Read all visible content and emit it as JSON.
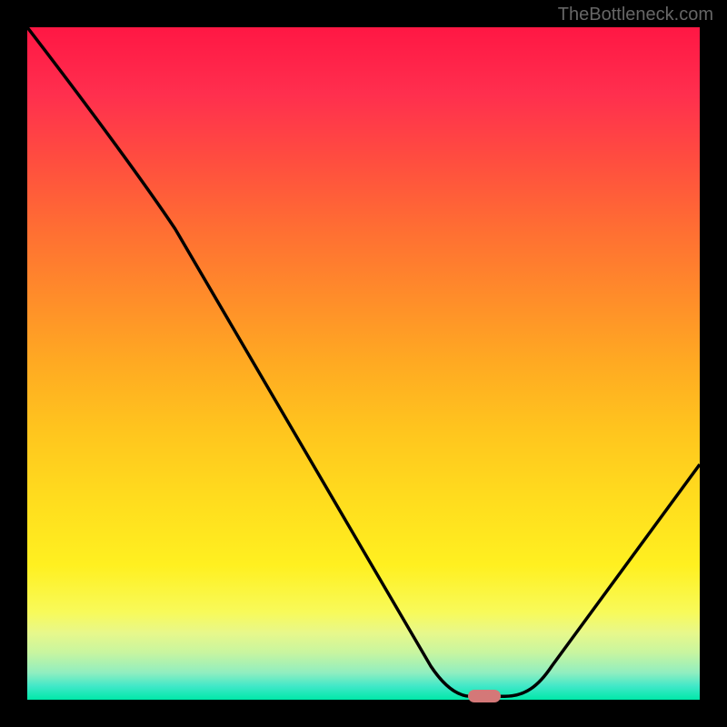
{
  "watermark": "TheBottleneck.com",
  "chart_data": {
    "type": "line",
    "title": "",
    "xlabel": "",
    "ylabel": "",
    "xlim": [
      0,
      100
    ],
    "ylim": [
      0,
      100
    ],
    "curve_points": [
      {
        "x": 0,
        "y": 100
      },
      {
        "x": 18,
        "y": 75
      },
      {
        "x": 22,
        "y": 70
      },
      {
        "x": 62,
        "y": 3
      },
      {
        "x": 65,
        "y": 0.5
      },
      {
        "x": 72,
        "y": 0.5
      },
      {
        "x": 76,
        "y": 2
      },
      {
        "x": 100,
        "y": 35
      }
    ],
    "minimum_point": {
      "x": 68,
      "y": 0.5
    },
    "marker_color": "#d47878",
    "gradient_colors": {
      "top": "#ff1744",
      "middle": "#ffc51e",
      "bottom": "#00e8a8"
    }
  }
}
